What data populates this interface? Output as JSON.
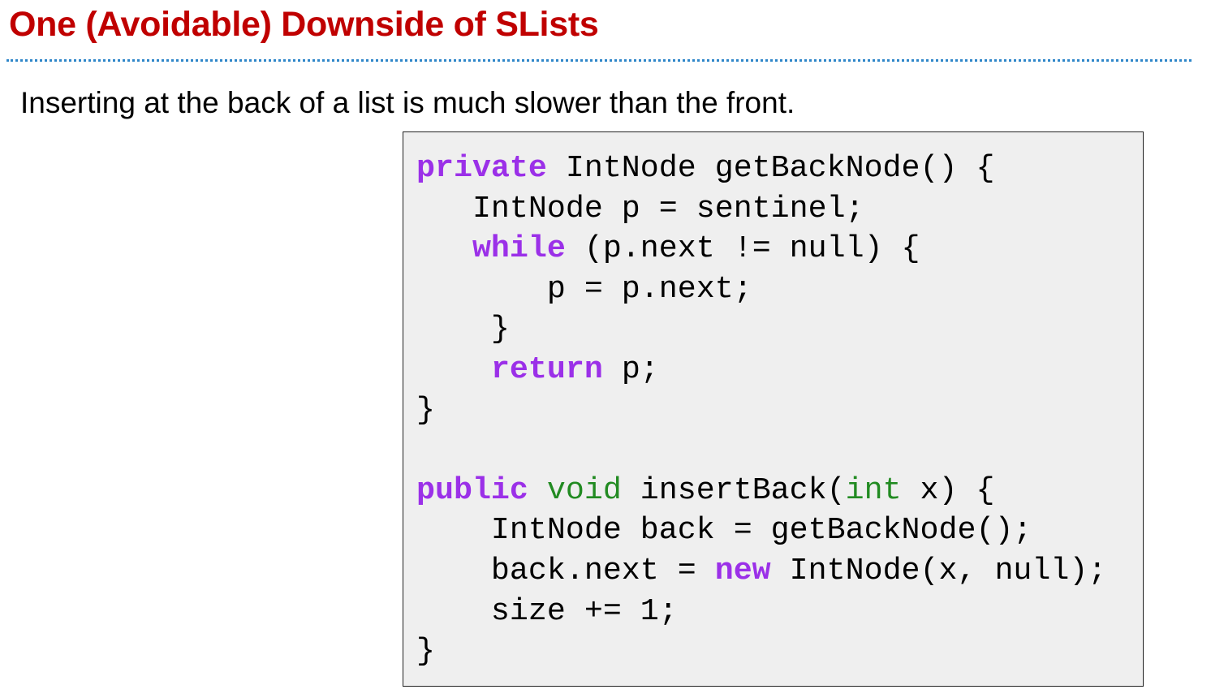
{
  "slide": {
    "title": "One (Avoidable) Downside of SLists",
    "subtitle": "Inserting at the back of a list is much slower than the front."
  },
  "colors": {
    "title": "#c00000",
    "keyword": "#9b30e8",
    "type": "#228b22",
    "rule": "#2e86c9",
    "code_bg": "#efefef"
  },
  "code_lines": [
    [
      [
        "private",
        "kw"
      ],
      [
        " IntNode getBackNode() {",
        ""
      ]
    ],
    [
      [
        "   IntNode p = sentinel;",
        ""
      ]
    ],
    [
      [
        "   ",
        ""
      ],
      [
        "while",
        "kw"
      ],
      [
        " (p.next != null) {",
        ""
      ]
    ],
    [
      [
        "       p = p.next;",
        ""
      ]
    ],
    [
      [
        "    }",
        ""
      ]
    ],
    [
      [
        "    ",
        ""
      ],
      [
        "return",
        "kw"
      ],
      [
        " p;",
        ""
      ]
    ],
    [
      [
        "}",
        ""
      ]
    ],
    [
      [
        "",
        ""
      ]
    ],
    [
      [
        "public",
        "kw"
      ],
      [
        " ",
        ""
      ],
      [
        "void",
        "ty"
      ],
      [
        " insertBack(",
        ""
      ],
      [
        "int",
        "ty"
      ],
      [
        " x) {",
        ""
      ]
    ],
    [
      [
        "    IntNode back = getBackNode();",
        ""
      ]
    ],
    [
      [
        "    back.next = ",
        ""
      ],
      [
        "new",
        "kw"
      ],
      [
        " IntNode(x, null);",
        ""
      ]
    ],
    [
      [
        "    size += 1;",
        ""
      ]
    ],
    [
      [
        "}",
        ""
      ]
    ]
  ]
}
